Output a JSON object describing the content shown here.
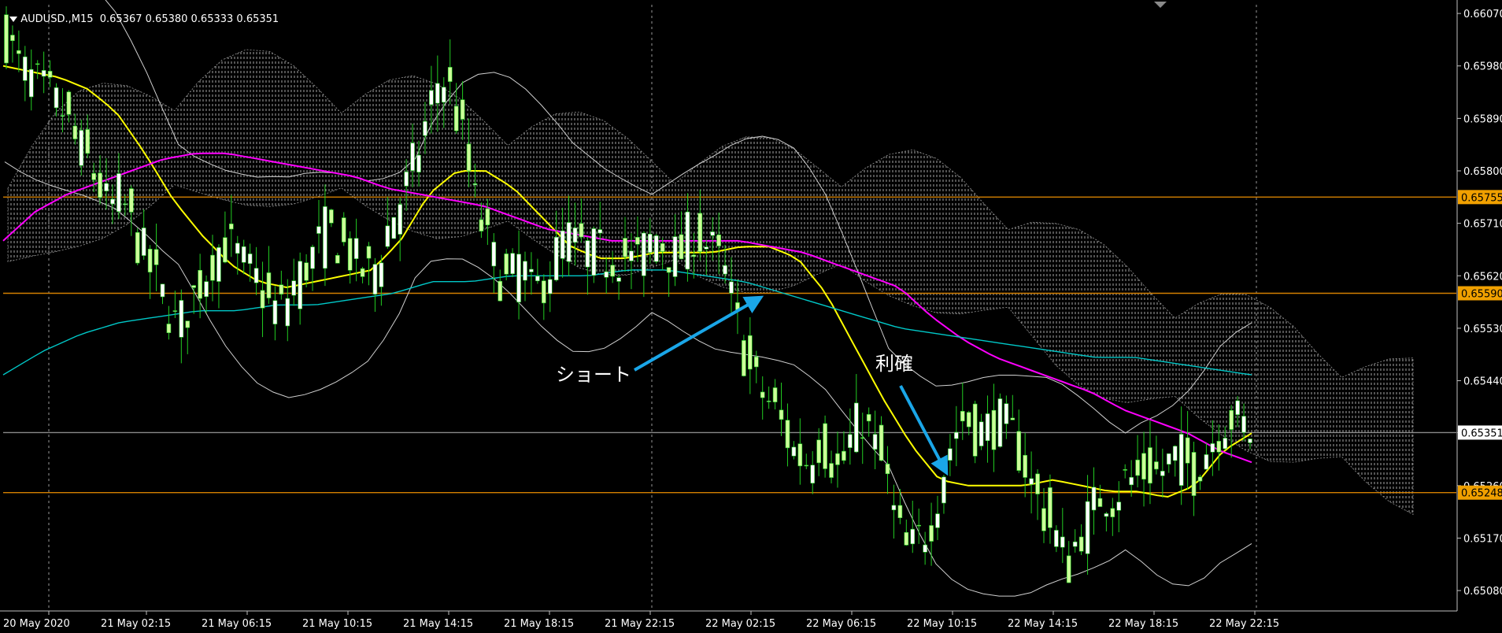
{
  "header": {
    "symbol": "AUDUSD.,M15",
    "ohlc": "0.65367 0.65380 0.65333 0.65351"
  },
  "annotations": {
    "short_label": "ショート",
    "take_profit_label": "利確"
  },
  "colors": {
    "background": "#000000",
    "axis": "#c0c0c0",
    "grid": "#c0c0c0",
    "candle_up": "#ffffff",
    "candle_body": "#ccff99",
    "candle_wick": "#22cc22",
    "ma_fast": "#ffff00",
    "ma_mid": "#ff00ff",
    "ma_slow": "#00c8c8",
    "bollinger": "#d0d0d0",
    "cloud": "#b0b0b0",
    "support_line": "#d48000",
    "price_line": "#8a8a8a",
    "arrow": "#1aa6e8",
    "label_orange_bg": "#f0a000"
  },
  "chart_data": {
    "type": "candlestick",
    "symbol": "AUDUSD.",
    "timeframe": "M15",
    "ylim": [
      0.65045,
      0.66085
    ],
    "y_ticks": [
      "0.66070",
      "0.65980",
      "0.65890",
      "0.65800",
      "0.65710",
      "0.65620",
      "0.65530",
      "0.65440",
      "0.65351",
      "0.65260",
      "0.65170",
      "0.65080"
    ],
    "x_ticks": [
      "20 May 2020",
      "21 May 02:15",
      "21 May 06:15",
      "21 May 10:15",
      "21 May 14:15",
      "21 May 18:15",
      "21 May 22:15",
      "22 May 02:15",
      "22 May 06:15",
      "22 May 10:15",
      "22 May 14:15",
      "22 May 18:15",
      "22 May 22:15"
    ],
    "vgrid_at": [
      "20 May 2020 22:00",
      "22 May 00:00",
      "23 May 00:00"
    ],
    "hlines": [
      {
        "value": 0.65755,
        "label": "0.65755",
        "kind": "support"
      },
      {
        "value": 0.6559,
        "label": "0.65590",
        "kind": "support"
      },
      {
        "value": 0.65248,
        "label": "0.65248",
        "kind": "support"
      },
      {
        "value": 0.65351,
        "label": "0.65351",
        "kind": "current_price"
      }
    ],
    "price_path": [
      0.6603,
      0.6598,
      0.6596,
      0.6594,
      0.6592,
      0.659,
      0.6585,
      0.6582,
      0.6578,
      0.6573,
      0.6576,
      0.657,
      0.6566,
      0.6561,
      0.6557,
      0.6553,
      0.6557,
      0.6561,
      0.6565,
      0.6568,
      0.6566,
      0.6563,
      0.6561,
      0.6557,
      0.6556,
      0.656,
      0.6563,
      0.6566,
      0.657,
      0.6568,
      0.6566,
      0.6563,
      0.6562,
      0.6568,
      0.6573,
      0.6577,
      0.6583,
      0.659,
      0.6597,
      0.6593,
      0.6585,
      0.6575,
      0.6568,
      0.6563,
      0.656,
      0.6565,
      0.6559,
      0.6561,
      0.6565,
      0.6569,
      0.6567,
      0.6566,
      0.6566,
      0.6565,
      0.6566,
      0.6564,
      0.6567,
      0.6569,
      0.6566,
      0.6565,
      0.657,
      0.6568,
      0.6566,
      0.6562,
      0.6554,
      0.6546,
      0.6542,
      0.654,
      0.6536,
      0.6532,
      0.653,
      0.6534,
      0.6532,
      0.6528,
      0.6534,
      0.6538,
      0.6533,
      0.6528,
      0.6519,
      0.6514,
      0.6517,
      0.652,
      0.6528,
      0.6535,
      0.6538,
      0.6535,
      0.6536,
      0.6537,
      0.6535,
      0.6531,
      0.6525,
      0.6521,
      0.6517,
      0.6512,
      0.6518,
      0.6521,
      0.6525,
      0.6524,
      0.6527,
      0.6527,
      0.6529,
      0.6528,
      0.653,
      0.6531,
      0.6528,
      0.6532,
      0.6535,
      0.6538,
      0.6537,
      0.6535
    ],
    "ma_fast": [
      0.6598,
      0.6597,
      0.6596,
      0.6594,
      0.659,
      0.6583,
      0.6575,
      0.6569,
      0.6564,
      0.6561,
      0.656,
      0.6561,
      0.6562,
      0.6563,
      0.6568,
      0.6576,
      0.658,
      0.658,
      0.6577,
      0.6572,
      0.6567,
      0.6565,
      0.6565,
      0.6566,
      0.6566,
      0.6566,
      0.6567,
      0.6567,
      0.6565,
      0.6559,
      0.655,
      0.6541,
      0.6533,
      0.6527,
      0.6526,
      0.6526,
      0.6526,
      0.6527,
      0.6526,
      0.6525,
      0.6525,
      0.6524,
      0.6526,
      0.6532,
      0.6535
    ],
    "ma_mid": [
      0.6568,
      0.6573,
      0.6576,
      0.6578,
      0.658,
      0.6582,
      0.6583,
      0.6583,
      0.6582,
      0.6581,
      0.658,
      0.6579,
      0.6577,
      0.6576,
      0.6575,
      0.6574,
      0.6572,
      0.657,
      0.6569,
      0.6568,
      0.6568,
      0.6568,
      0.6568,
      0.6568,
      0.6567,
      0.6566,
      0.6564,
      0.6562,
      0.656,
      0.6555,
      0.6551,
      0.6548,
      0.6546,
      0.6544,
      0.6542,
      0.6539,
      0.6537,
      0.6535,
      0.6532,
      0.653
    ],
    "ma_slow": [
      0.6545,
      0.6549,
      0.6552,
      0.6554,
      0.6555,
      0.6556,
      0.6556,
      0.6557,
      0.6557,
      0.6558,
      0.6559,
      0.6561,
      0.6561,
      0.6562,
      0.6562,
      0.6562,
      0.6563,
      0.6563,
      0.6562,
      0.6561,
      0.6559,
      0.6557,
      0.6555,
      0.6553,
      0.6552,
      0.6551,
      0.655,
      0.6549,
      0.6548,
      0.6548,
      0.6547,
      0.6546,
      0.6545
    ]
  }
}
